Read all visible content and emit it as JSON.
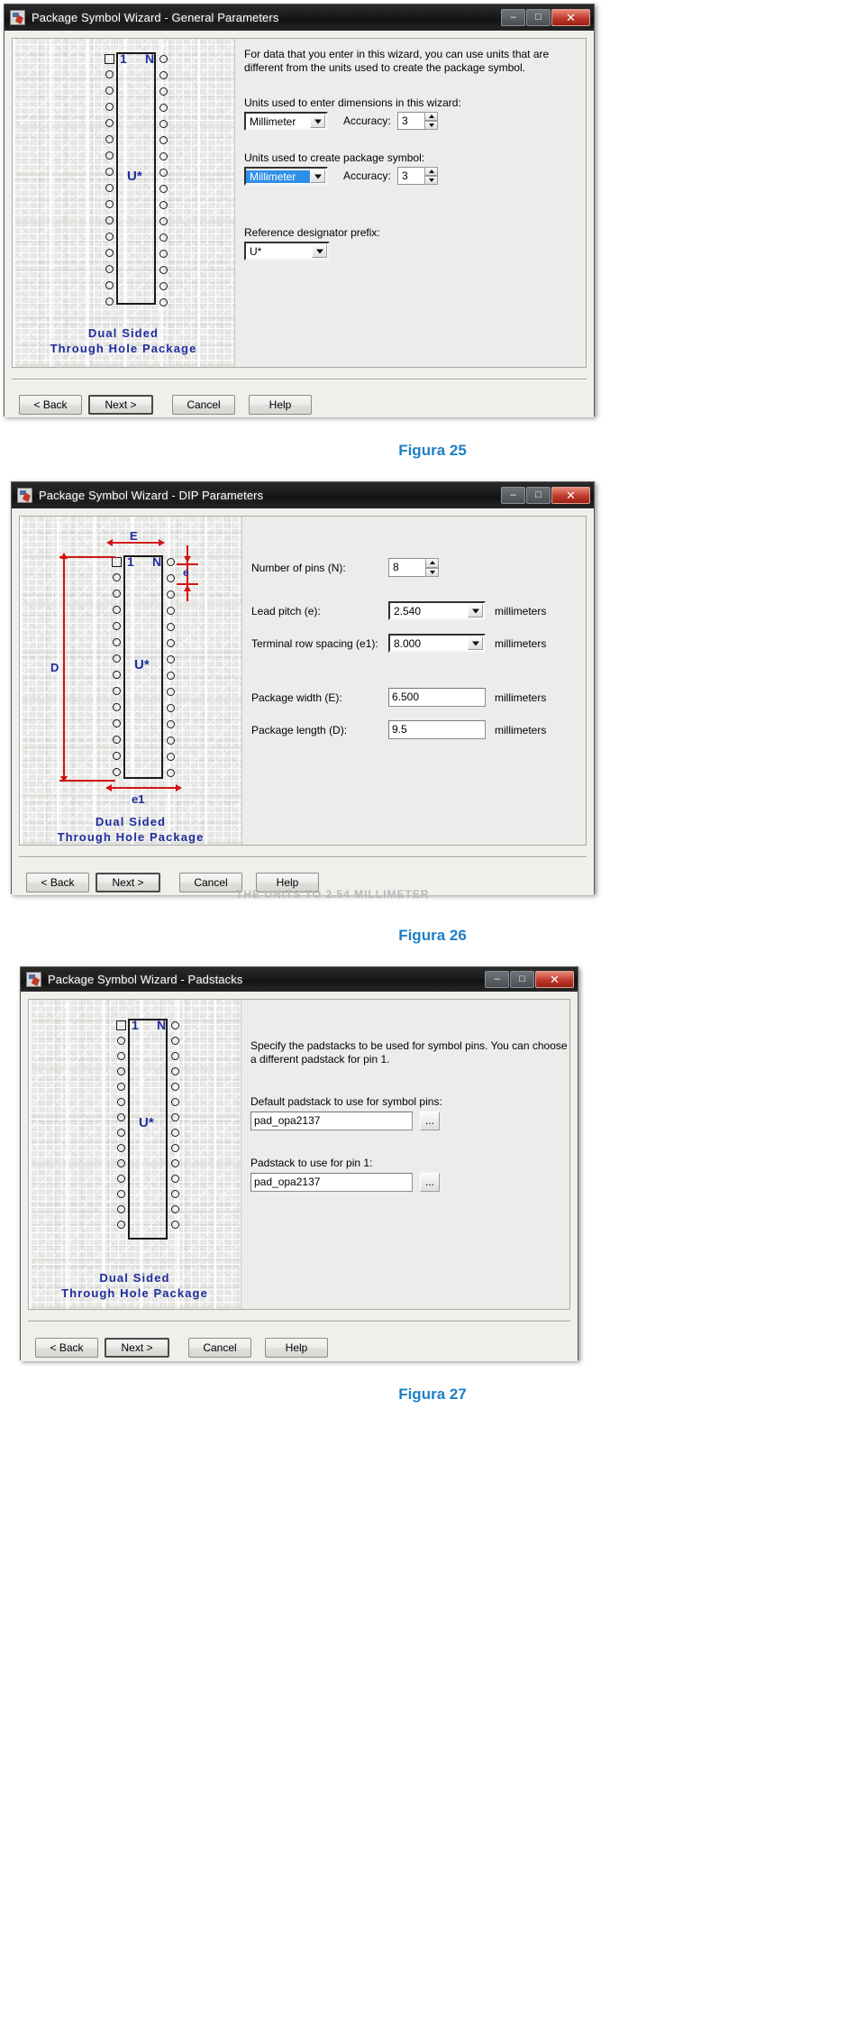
{
  "page": {
    "figure_captions": [
      {
        "id": "figura-25",
        "text": "Figura 25"
      },
      {
        "id": "figura-26",
        "text": "Figura 26"
      },
      {
        "id": "figura-27",
        "text": "Figura 27"
      }
    ],
    "bleed_text": "THE UNITS TO 2.54 MILLIMETER"
  },
  "common": {
    "window_icon": "wizard-app-icon",
    "minimize_label": "–",
    "maximize_label": "□",
    "close_label": "✕",
    "buttons": {
      "back": "< Back",
      "next": "Next >",
      "cancel": "Cancel",
      "help": "Help"
    },
    "preview_caption_line1": "Dual Sided",
    "preview_caption_line2": "Through Hole Package",
    "package_labels": {
      "pin1": "1",
      "pinN": "N",
      "refdes": "U*"
    },
    "accent_blue": "#1f2c9e",
    "dimension_red": "#d01414",
    "selection_blue": "#2f8fe8",
    "caption_color": "#1f7fc4"
  },
  "dialog1": {
    "title": "Package Symbol Wizard - General Parameters",
    "intro_line1": "For data that you enter in this wizard, you can use units that are",
    "intro_line2": "different from the units used to create the package symbol.",
    "field_units_enter_label": "Units used to enter dimensions in this wizard:",
    "field_units_enter_value": "Millimeter",
    "field_units_enter_accuracy_label": "Accuracy:",
    "field_units_enter_accuracy_value": "3",
    "field_units_create_label": "Units used to create package symbol:",
    "field_units_create_value": "Millimeter",
    "field_units_create_accuracy_label": "Accuracy:",
    "field_units_create_accuracy_value": "3",
    "field_refdes_label": "Reference designator prefix:",
    "field_refdes_value": "U*"
  },
  "dialog2": {
    "title": "Package Symbol Wizard - DIP Parameters",
    "fields": [
      {
        "label": "Number of pins (N):",
        "value": "8",
        "unit": "",
        "type": "spinner"
      },
      {
        "label": "Lead pitch (e):",
        "value": "2.540",
        "unit": "millimeters",
        "type": "combo"
      },
      {
        "label": "Terminal row spacing (e1):",
        "value": "8.000",
        "unit": "millimeters",
        "type": "combo"
      },
      {
        "label": "Package width (E):",
        "value": "6.500",
        "unit": "millimeters",
        "type": "text"
      },
      {
        "label": "Package length (D):",
        "value": "9.5",
        "unit": "millimeters",
        "type": "text"
      }
    ],
    "dimension_labels": {
      "E": "E",
      "e": "e",
      "D": "D",
      "e1": "e1"
    }
  },
  "dialog3": {
    "title": "Package Symbol Wizard - Padstacks",
    "intro_line1": "Specify the padstacks to be used for symbol pins. You can choose",
    "intro_line2": "a different padstack for pin 1.",
    "field_default_label": "Default padstack to use for symbol pins:",
    "field_default_value": "pad_opa2137",
    "field_pin1_label": "Padstack to use for pin 1:",
    "field_pin1_value": "pad_opa2137",
    "browse_label": "..."
  }
}
